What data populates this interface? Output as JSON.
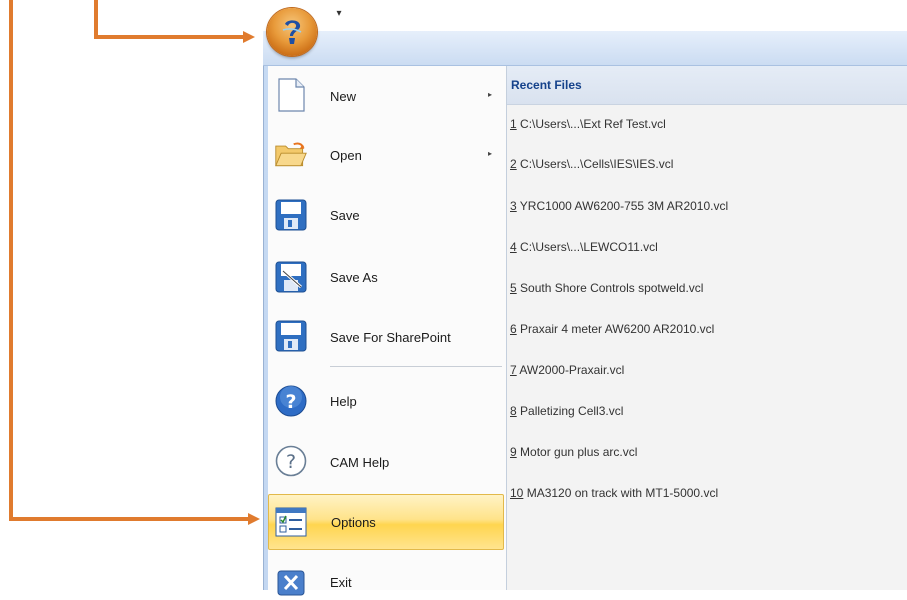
{
  "menu": {
    "commands": [
      {
        "label": "New",
        "icon": "new-document-icon",
        "has_submenu": true
      },
      {
        "label": "Open",
        "icon": "open-folder-icon",
        "has_submenu": true
      },
      {
        "label": "Save",
        "icon": "save-icon",
        "has_submenu": false
      },
      {
        "label": "Save As",
        "icon": "save-as-icon",
        "has_submenu": false
      },
      {
        "label": "Save For SharePoint",
        "icon": "save-sharepoint-icon",
        "has_submenu": false
      },
      {
        "label": "Help",
        "icon": "help-icon",
        "has_submenu": false
      },
      {
        "label": "CAM Help",
        "icon": "cam-help-icon",
        "has_submenu": false
      },
      {
        "label": "Options",
        "icon": "options-icon",
        "has_submenu": false,
        "selected": true
      },
      {
        "label": "Exit",
        "icon": "exit-icon",
        "has_submenu": false
      }
    ],
    "submenu_glyph": "▸"
  },
  "recent": {
    "title": "Recent Files",
    "items": [
      {
        "num": "1",
        "text": " C:\\Users\\...\\Ext Ref Test.vcl"
      },
      {
        "num": "2",
        "text": " C:\\Users\\...\\Cells\\IES\\IES.vcl"
      },
      {
        "num": "3",
        "text": " YRC1000 AW6200-755 3M AR2010.vcl"
      },
      {
        "num": "4",
        "text": " C:\\Users\\...\\LEWCO11.vcl"
      },
      {
        "num": "5",
        "text": " South Shore Controls spotweld.vcl"
      },
      {
        "num": "6",
        "text": " Praxair 4 meter AW6200 AR2010.vcl"
      },
      {
        "num": "7",
        "text": " AW2000-Praxair.vcl"
      },
      {
        "num": "8",
        "text": " Palletizing Cell3.vcl"
      },
      {
        "num": "9",
        "text": " Motor gun plus arc.vcl"
      },
      {
        "num": "10",
        "text": " MA3120 on track with MT1-5000.vcl"
      }
    ]
  },
  "qat": {
    "dropdown_glyph": "▾"
  },
  "colors": {
    "annotation_arrow": "#e07b2e",
    "selected_highlight": "#ffd54f",
    "recent_title": "#15428b"
  }
}
